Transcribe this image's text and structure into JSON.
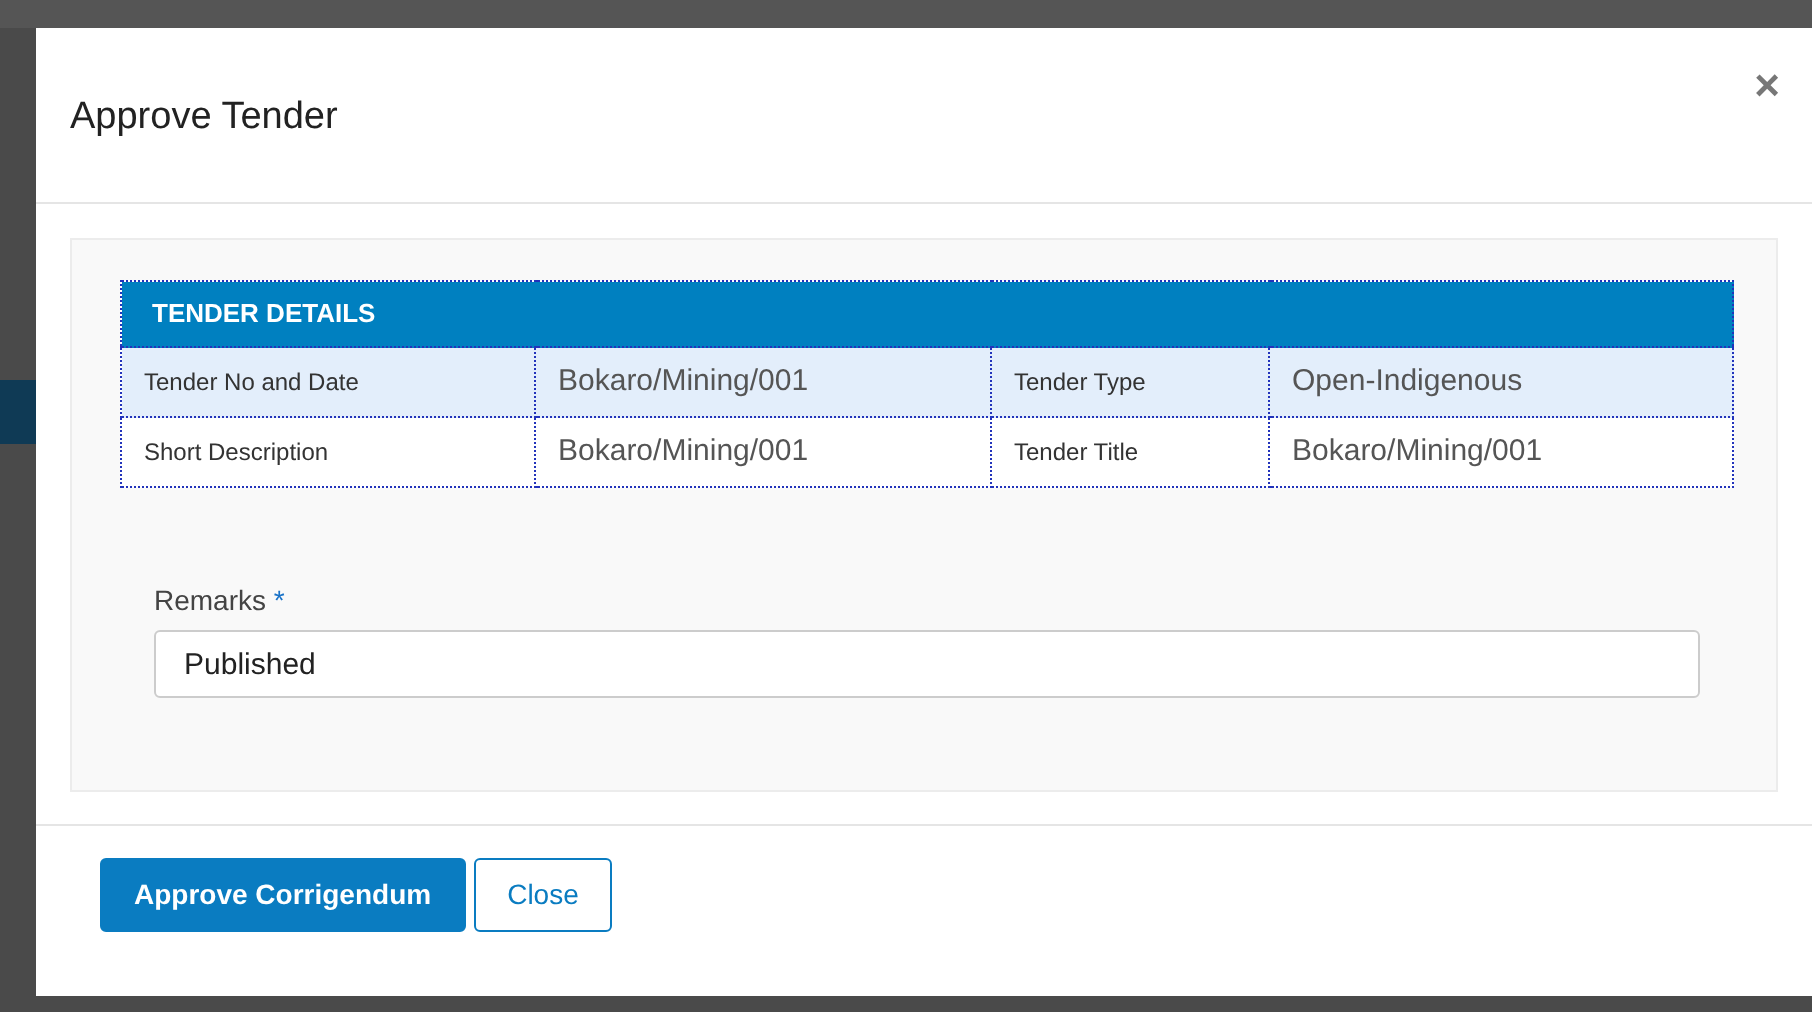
{
  "dialog": {
    "title": "Approve Tender",
    "close": "×"
  },
  "details": {
    "heading": "TENDER DETAILS",
    "rows": [
      {
        "label_1": "Tender No and Date",
        "value_1": "Bokaro/Mining/001",
        "label_2": "Tender Type",
        "value_2": "Open-Indigenous"
      },
      {
        "label_1": "Short Description",
        "value_1": "Bokaro/Mining/001",
        "label_2": "Tender Title",
        "value_2": "Bokaro/Mining/001"
      }
    ]
  },
  "remarks": {
    "label": "Remarks",
    "required_mark": "*",
    "value": "Published"
  },
  "buttons": [
    {
      "label": "Approve Corrigendum",
      "kind": "primary"
    },
    {
      "label": "Close",
      "kind": "secondary"
    }
  ]
}
